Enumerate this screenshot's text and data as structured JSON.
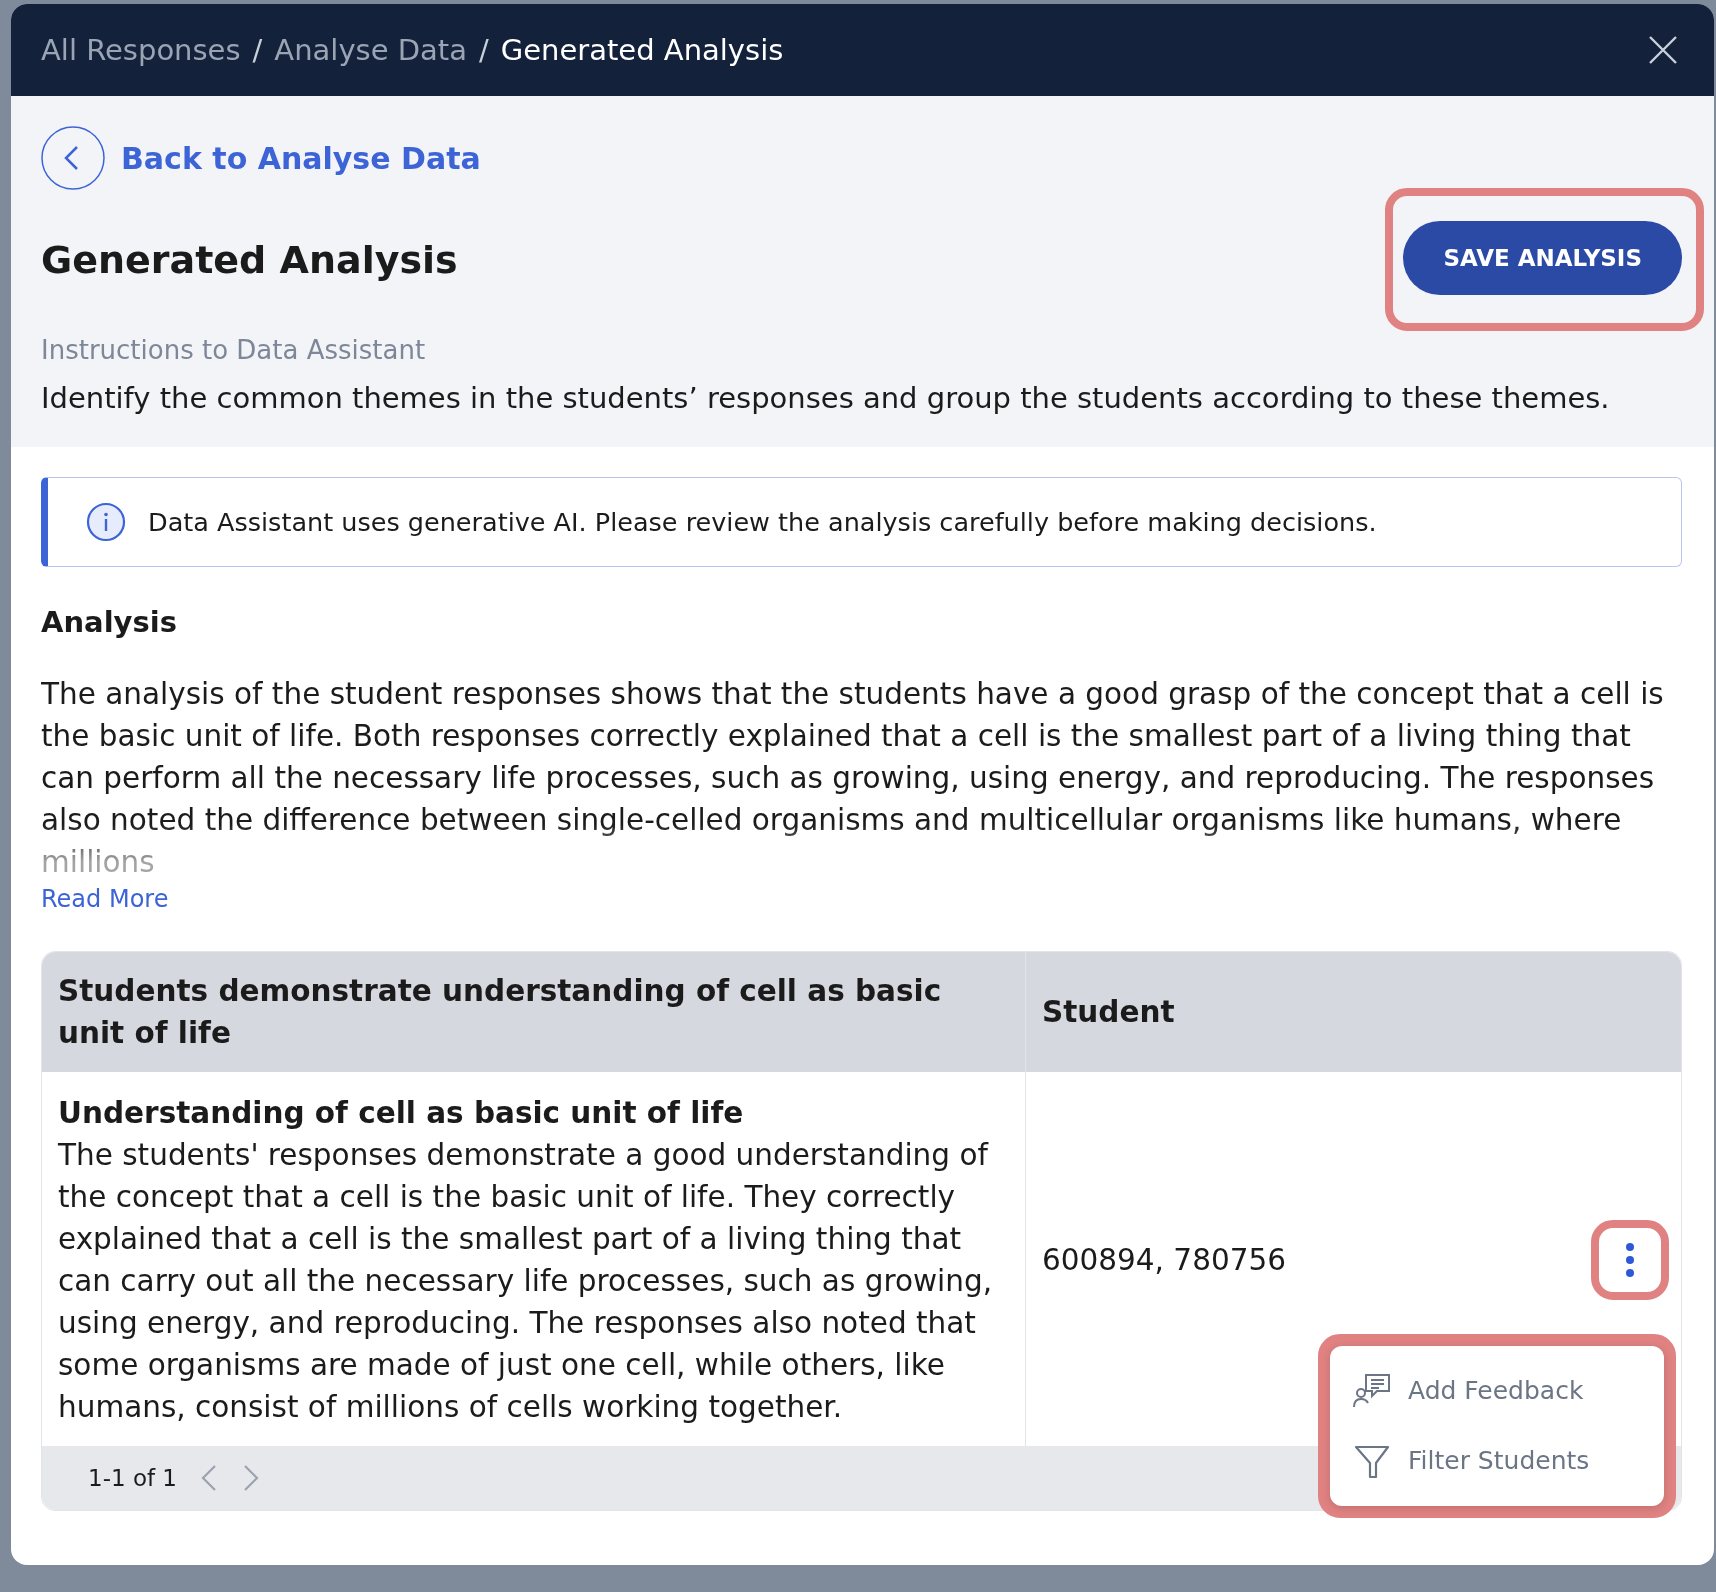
{
  "breadcrumb": [
    {
      "label": "All Responses",
      "separator": "/",
      "current": false
    },
    {
      "label": "Analyse Data",
      "separator": "/",
      "current": false
    },
    {
      "label": "Generated Analysis",
      "current": true
    }
  ],
  "back_link": "Back to Analyse Data",
  "title": "Generated Analysis",
  "save_button": "SAVE ANALYSIS",
  "instructions": {
    "label": "Instructions to Data Assistant",
    "text": "Identify the common themes in the students’ responses and group the students according to these themes."
  },
  "notice": "Data Assistant uses generative AI. Please review the analysis carefully before making decisions.",
  "analysis": {
    "heading": "Analysis",
    "text": "The analysis of the student responses shows that the students have a good grasp of the concept that a cell is the basic unit of life. Both responses correctly explained that a cell is the smallest part of a living thing that can perform all the necessary life processes, such as growing, using energy, and reproducing. The responses also noted the difference between single-celled organisms and multicellular organisms like humans, where millions",
    "read_more": "Read More"
  },
  "table": {
    "columns": [
      "Students demonstrate understanding of cell as basic unit of life",
      "Student"
    ],
    "rows": [
      {
        "title": "Understanding of cell as basic unit of life",
        "description": "The students' responses demonstrate a good understanding of the concept that a cell is the basic unit of life. They correctly explained that a cell is the smallest part of a living thing that can carry out all the necessary life processes, such as growing, using energy, and reproducing. The responses also noted that some organisms are made of just one cell, while others, like humans, consist of millions of cells working together.",
        "students": "600894, 780756",
        "menu_expanded": true
      }
    ],
    "pagination": "1-1 of 1"
  },
  "row_menu": [
    {
      "label": "Add Feedback",
      "kind": "feedback"
    },
    {
      "label": "Filter Students",
      "kind": "filter"
    }
  ]
}
